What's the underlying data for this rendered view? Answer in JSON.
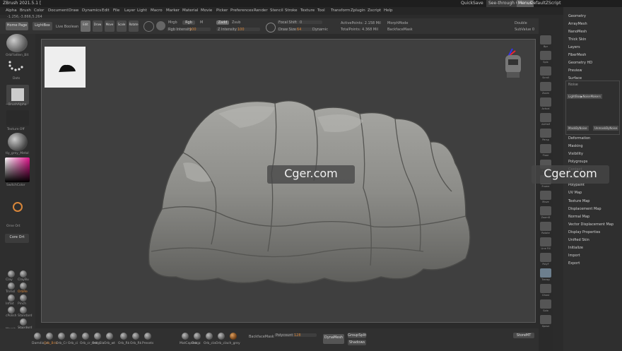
{
  "titlebar": {
    "title": "ZBrush 2021.5.1 [",
    "quicksave": "QuickSave",
    "see_through": "See-through",
    "see_through_value": "0",
    "menus": "Menus",
    "default_zscript": "DefaultZScript"
  },
  "menubar": [
    "Alpha",
    "Brush",
    "Color",
    "Document",
    "Draw",
    "Dynamics",
    "Edit",
    "File",
    "Layer",
    "Light",
    "Macro",
    "Marker",
    "Material",
    "Movie",
    "Picker",
    "Preferences",
    "Render",
    "Stencil",
    "Stroke",
    "Texture",
    "Tool",
    "Transform",
    "Zplugin",
    "Zscript",
    "Help"
  ],
  "coords": "-1.256,-3.866,5.264",
  "shelf": {
    "home_page": "Home Page",
    "lightbox": "LightBox",
    "live_boolean": "Live Boolean",
    "edit": "Edit",
    "draw": "Draw",
    "move": "Move",
    "scale": "Scale",
    "rotate": "Rotate",
    "mrgb": "Mrgb",
    "rgb": "Rgb",
    "m": "M",
    "rgb_intensity_label": "Rgb Intensity",
    "rgb_intensity_value": "100",
    "zadd": "Zadd",
    "zsub": "Zsub",
    "z_intensity_label": "Z Intensity",
    "z_intensity_value": "100",
    "focal_shift_label": "Focal Shift",
    "focal_shift_value": "0",
    "draw_size_label": "Draw Size",
    "draw_size_value": "64",
    "dynamic": "Dynamic",
    "active_points": "ActivePoints: 2.158 Mil",
    "total_points": "TotalPoints: 4.368 Mil",
    "morph_mode": "MorphMode",
    "backface_mask": "BackfaceMask",
    "double": "Double",
    "subdivide": "SubValue",
    "subdivide_value": "0"
  },
  "leftpanel": {
    "orb": "OrbFlatten_Bit",
    "dots": "Dots",
    "alpha": "~BrushAlpha",
    "texture_off": "Texture Off",
    "material": "tiy_grey_Metal",
    "swatch": "SwitchColor",
    "orb_orange": "Orne Ort",
    "cuts": "Core Ort",
    "brushes": [
      "Clay",
      "ClayBu",
      "Trimsl",
      "OrbRe",
      "Inflat",
      "Pinch",
      "cPolish",
      "Standard",
      "Standard"
    ],
    "morph": "Morph",
    "orb_cr": "Orb_Cr"
  },
  "bottom": {
    "brushes": [
      "Damdio_st",
      "Orb_Bris",
      "Orb_Cr",
      "Orb_ci",
      "Orb_cr_melo",
      "Orb_Sla",
      "Orb_wt",
      "Orb_Rk",
      "Orb_Rk",
      "Presets"
    ],
    "materials": [
      "MatCapBasic",
      "Orb_c",
      "Orb_cla",
      "Orb_cla",
      "ch_grey"
    ],
    "backface_mask": "BackfaceMask",
    "polycount": "Polycount",
    "polycount_value": "128",
    "dynamesh": "DynaMesh",
    "groups_split": "GroupSplit",
    "shadows": "Shadows",
    "store_mt": "StoreMT"
  },
  "rstrip": [
    "Bpr",
    "Spix",
    "Scroll",
    "Zoom",
    "Actual",
    "AAHalf",
    "Persp",
    "Floor",
    "L.Sym",
    "Frame",
    "Move",
    "ZoomD",
    "Rotate",
    "Line Fill",
    "PolyF",
    "Transp",
    "Ghost",
    "Solo",
    "Xpose"
  ],
  "rpal": [
    "Geometry",
    "ArrayMesh",
    "NanoMesh",
    "Thick Skin",
    "Layers",
    "FiberMesh",
    "Geometry HD",
    "Preview",
    "Surface",
    "Noise",
    "LightBox▶NoiseMakers",
    "MaskByNoise",
    "UnmaskByNoise",
    "Deformation",
    "Masking",
    "Visibility",
    "Polygroups",
    "Contact",
    "Morph Target",
    "Polypaint",
    "UV Map",
    "Texture Map",
    "Displacement Map",
    "Normal Map",
    "Vector Displacement Map",
    "Display Properties",
    "Unified Skin",
    "Initialize",
    "Import",
    "Export"
  ],
  "watermark": "Cger.com",
  "colors": {
    "accent": "#d8863a",
    "panel": "#2e2e2e",
    "canvas": "#3f3f3f"
  }
}
